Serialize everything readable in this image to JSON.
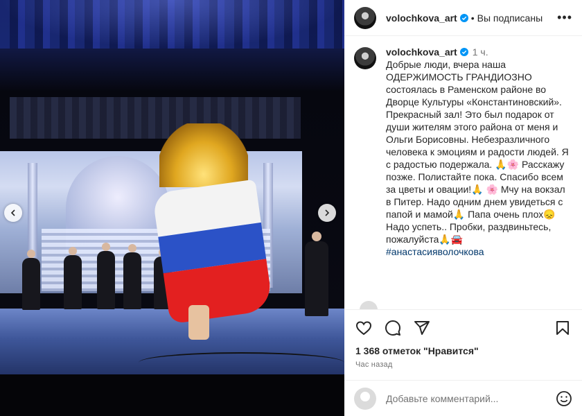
{
  "header": {
    "username": "volochkova_art",
    "dot": "•",
    "follow_status": "Вы подписаны",
    "more": "•••"
  },
  "caption": {
    "username": "volochkova_art",
    "time": "1 ч.",
    "text": "Добрые люди, вчера наша ОДЕРЖИМОСТЬ ГРАНДИОЗНО состоялась в Раменском районе во Дворце Культуры «Константиновский». Прекрасный зал! Это был подарок от души жителям этого района от меня и Ольги Борисовны. Небезразличного человека к эмоциям и радости людей. Я с радостью подержала. 🙏🌸 Расскажу позже. Полистайте пока. Спасибо всем за цветы и овации!🙏 🌸 Мчу на вокзал в Питер. Надо одним днем увидеться с папой и мамой🙏 Папа очень плох😞 Надо успеть.. Пробки, раздвиньтесь, пожалуйста🙏🚘",
    "hashtag": "#анастасияволочкова"
  },
  "media": {
    "prev_icon": "chevron-left-icon",
    "next_icon": "chevron-right-icon"
  },
  "actions": {
    "like_icon": "heart-icon",
    "comment_icon": "comment-icon",
    "share_icon": "share-icon",
    "save_icon": "bookmark-icon"
  },
  "likes": "1 368 отметок \"Нравится\"",
  "posted_ago": "Час назад",
  "comment": {
    "placeholder": "Добавьте комментарий..."
  },
  "colors": {
    "verified": "#0095f6",
    "link": "#00376b",
    "muted": "#737373"
  }
}
